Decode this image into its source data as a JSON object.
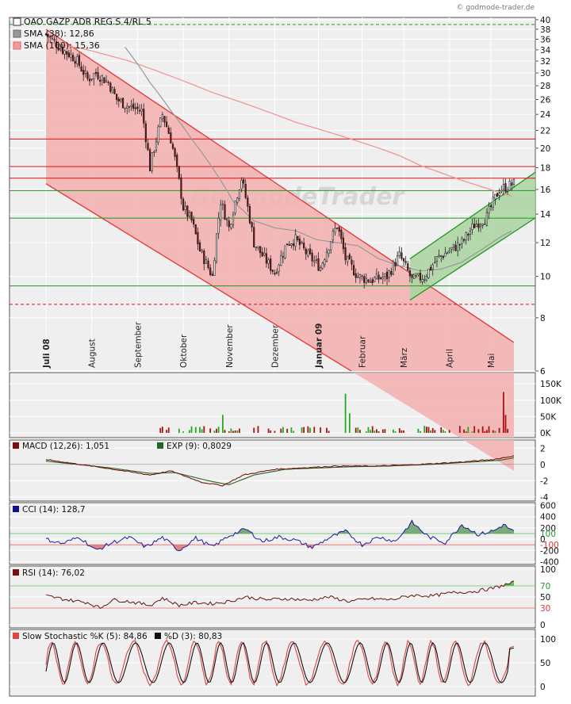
{
  "source": "© godmode-trader.de",
  "watermark": "GodmodeTrader",
  "chart_data": {
    "type": "candlestick",
    "title": "OAO GAZP ADR REG.S 4/RL 5",
    "legend": [
      {
        "label": "SMA (38): 12,86",
        "color": "#999999"
      },
      {
        "label": "SMA (100): 15,36",
        "color": "#ee8080"
      }
    ],
    "y_axis": {
      "scale": "log",
      "ylim": [
        6,
        40.5
      ],
      "ticks": [
        40,
        38,
        36,
        34,
        32,
        30,
        28,
        26,
        24,
        22,
        20,
        18,
        16,
        14,
        12,
        10,
        8,
        6
      ]
    },
    "x_labels": [
      "Juli 08",
      "August",
      "September",
      "Oktober",
      "November",
      "Dezember",
      "Januar 09",
      "Februar",
      "März",
      "April",
      "Mai"
    ],
    "x_labels_bold": [
      "Juli 08",
      "Januar 09"
    ],
    "n_bars": 226,
    "closes": [
      {
        "i": 0,
        "v": 37.0
      },
      {
        "i": 8,
        "v": 34.0
      },
      {
        "i": 14,
        "v": 32.5
      },
      {
        "i": 20,
        "v": 29.0
      },
      {
        "i": 24,
        "v": 30.0
      },
      {
        "i": 30,
        "v": 28.5
      },
      {
        "i": 34,
        "v": 26.0
      },
      {
        "i": 40,
        "v": 25.0
      },
      {
        "i": 46,
        "v": 24.5
      },
      {
        "i": 50,
        "v": 18.0
      },
      {
        "i": 56,
        "v": 24.0
      },
      {
        "i": 60,
        "v": 21.0
      },
      {
        "i": 66,
        "v": 14.5
      },
      {
        "i": 70,
        "v": 13.5
      },
      {
        "i": 74,
        "v": 11.5
      },
      {
        "i": 80,
        "v": 10.0
      },
      {
        "i": 84,
        "v": 15.0
      },
      {
        "i": 88,
        "v": 13.0
      },
      {
        "i": 94,
        "v": 17.0
      },
      {
        "i": 100,
        "v": 12.0
      },
      {
        "i": 104,
        "v": 11.2
      },
      {
        "i": 110,
        "v": 10.2
      },
      {
        "i": 116,
        "v": 12.0
      },
      {
        "i": 120,
        "v": 12.2
      },
      {
        "i": 126,
        "v": 11.2
      },
      {
        "i": 132,
        "v": 10.5
      },
      {
        "i": 140,
        "v": 13.2
      },
      {
        "i": 144,
        "v": 11.0
      },
      {
        "i": 150,
        "v": 10.0
      },
      {
        "i": 156,
        "v": 9.8
      },
      {
        "i": 164,
        "v": 10.0
      },
      {
        "i": 170,
        "v": 11.2
      },
      {
        "i": 176,
        "v": 9.8
      },
      {
        "i": 182,
        "v": 10.0
      },
      {
        "i": 188,
        "v": 11.0
      },
      {
        "i": 194,
        "v": 11.5
      },
      {
        "i": 200,
        "v": 12.0
      },
      {
        "i": 206,
        "v": 13.2
      },
      {
        "i": 212,
        "v": 13.8
      },
      {
        "i": 218,
        "v": 16.0
      },
      {
        "i": 225,
        "v": 16.5
      }
    ],
    "sma38": [
      {
        "i": 38,
        "v": 34.5
      },
      {
        "i": 50,
        "v": 28.5
      },
      {
        "i": 60,
        "v": 24.5
      },
      {
        "i": 70,
        "v": 21.0
      },
      {
        "i": 80,
        "v": 18.0
      },
      {
        "i": 90,
        "v": 15.0
      },
      {
        "i": 100,
        "v": 13.5
      },
      {
        "i": 110,
        "v": 13.0
      },
      {
        "i": 120,
        "v": 12.8
      },
      {
        "i": 130,
        "v": 12.2
      },
      {
        "i": 140,
        "v": 12.0
      },
      {
        "i": 150,
        "v": 11.8
      },
      {
        "i": 160,
        "v": 11.0
      },
      {
        "i": 170,
        "v": 10.6
      },
      {
        "i": 180,
        "v": 10.3
      },
      {
        "i": 190,
        "v": 10.4
      },
      {
        "i": 200,
        "v": 10.8
      },
      {
        "i": 210,
        "v": 11.6
      },
      {
        "i": 220,
        "v": 12.5
      },
      {
        "i": 225,
        "v": 12.86
      }
    ],
    "sma100": [
      {
        "i": 0,
        "v": 35.5
      },
      {
        "i": 20,
        "v": 34.0
      },
      {
        "i": 40,
        "v": 32.0
      },
      {
        "i": 60,
        "v": 29.5
      },
      {
        "i": 80,
        "v": 27.0
      },
      {
        "i": 100,
        "v": 25.0
      },
      {
        "i": 120,
        "v": 23.0
      },
      {
        "i": 140,
        "v": 21.5
      },
      {
        "i": 160,
        "v": 20.0
      },
      {
        "i": 170,
        "v": 19.2
      },
      {
        "i": 180,
        "v": 18.2
      },
      {
        "i": 190,
        "v": 17.5
      },
      {
        "i": 200,
        "v": 16.8
      },
      {
        "i": 210,
        "v": 16.2
      },
      {
        "i": 225,
        "v": 15.36
      }
    ],
    "horizontal_lines": [
      {
        "v": 39.0,
        "style": "dashed",
        "color": "#229922"
      },
      {
        "v": 21.0,
        "style": "solid",
        "color": "#dd1111"
      },
      {
        "v": 18.1,
        "style": "solid",
        "color": "#dd1111"
      },
      {
        "v": 17.0,
        "style": "solid",
        "color": "#dd1111"
      },
      {
        "v": 15.9,
        "style": "solid",
        "color": "#229922"
      },
      {
        "v": 13.7,
        "style": "solid",
        "color": "#229922"
      },
      {
        "v": 9.5,
        "style": "solid",
        "color": "#229922"
      },
      {
        "v": 8.6,
        "style": "dashed",
        "color": "#dd1111"
      }
    ],
    "down_channel": {
      "upper": [
        [
          0,
          38.0
        ],
        [
          225,
          7.0
        ]
      ],
      "lower": [
        [
          0,
          16.5
        ],
        [
          225,
          3.5
        ]
      ],
      "color": "#e53333",
      "fill": "#f3b3b3"
    },
    "up_channel": {
      "upper": [
        [
          175,
          11.0
        ],
        [
          240,
          18.2
        ]
      ],
      "lower": [
        [
          175,
          8.8
        ],
        [
          240,
          14.2
        ]
      ],
      "color": "#229922",
      "fill": "#a9d4a0"
    },
    "volume": {
      "ticks": [
        "150K",
        "100K",
        "50K",
        "0K"
      ],
      "ymax": 170,
      "spikes": [
        {
          "i": 85,
          "v": 55
        },
        {
          "i": 144,
          "v": 120
        },
        {
          "i": 146,
          "v": 60
        },
        {
          "i": 220,
          "v": 125
        },
        {
          "i": 221,
          "v": 55
        }
      ],
      "green": "#22aa22",
      "red": "#aa1111"
    },
    "macd": {
      "label": "MACD (12,26): 1,051",
      "signal_label": "EXP (9): 0,8029",
      "ticks": [
        "2",
        "0",
        "-2",
        "-4"
      ],
      "ylim": [
        -4.5,
        3
      ],
      "line": [
        {
          "i": 0,
          "v": 0.6
        },
        {
          "i": 30,
          "v": -0.5
        },
        {
          "i": 50,
          "v": -1.3
        },
        {
          "i": 60,
          "v": -0.8
        },
        {
          "i": 75,
          "v": -2.2
        },
        {
          "i": 85,
          "v": -2.6
        },
        {
          "i": 95,
          "v": -1.3
        },
        {
          "i": 110,
          "v": -0.6
        },
        {
          "i": 140,
          "v": -0.2
        },
        {
          "i": 160,
          "v": -0.2
        },
        {
          "i": 180,
          "v": 0
        },
        {
          "i": 200,
          "v": 0.3
        },
        {
          "i": 215,
          "v": 0.6
        },
        {
          "i": 225,
          "v": 1.05
        }
      ],
      "signal": [
        {
          "i": 0,
          "v": 0.4
        },
        {
          "i": 30,
          "v": -0.4
        },
        {
          "i": 50,
          "v": -1.1
        },
        {
          "i": 62,
          "v": -1.0
        },
        {
          "i": 78,
          "v": -2.0
        },
        {
          "i": 88,
          "v": -2.5
        },
        {
          "i": 100,
          "v": -1.3
        },
        {
          "i": 115,
          "v": -0.6
        },
        {
          "i": 145,
          "v": -0.3
        },
        {
          "i": 165,
          "v": -0.2
        },
        {
          "i": 185,
          "v": 0
        },
        {
          "i": 205,
          "v": 0.3
        },
        {
          "i": 218,
          "v": 0.5
        },
        {
          "i": 225,
          "v": 0.8
        }
      ]
    },
    "cci": {
      "label": "CCI (14): 128,7",
      "ticks": [
        "600",
        "400",
        "200",
        "100",
        "0",
        "-100",
        "-200",
        "-400"
      ],
      "ticks_colored": {
        "100": "#229922",
        "-100": "#dd3333"
      },
      "ylim": [
        -450,
        650
      ],
      "line": [
        {
          "i": 0,
          "v": 0
        },
        {
          "i": 8,
          "v": -80
        },
        {
          "i": 16,
          "v": 40
        },
        {
          "i": 24,
          "v": -200
        },
        {
          "i": 32,
          "v": -60
        },
        {
          "i": 40,
          "v": 30
        },
        {
          "i": 48,
          "v": -140
        },
        {
          "i": 56,
          "v": 30
        },
        {
          "i": 64,
          "v": -200
        },
        {
          "i": 72,
          "v": 20
        },
        {
          "i": 80,
          "v": -140
        },
        {
          "i": 88,
          "v": 60
        },
        {
          "i": 96,
          "v": 180
        },
        {
          "i": 104,
          "v": -40
        },
        {
          "i": 112,
          "v": 40
        },
        {
          "i": 120,
          "v": -20
        },
        {
          "i": 128,
          "v": -150
        },
        {
          "i": 136,
          "v": 20
        },
        {
          "i": 144,
          "v": 140
        },
        {
          "i": 152,
          "v": -100
        },
        {
          "i": 160,
          "v": 40
        },
        {
          "i": 168,
          "v": -40
        },
        {
          "i": 176,
          "v": 300
        },
        {
          "i": 184,
          "v": 40
        },
        {
          "i": 192,
          "v": -60
        },
        {
          "i": 200,
          "v": 260
        },
        {
          "i": 208,
          "v": 80
        },
        {
          "i": 216,
          "v": 160
        },
        {
          "i": 220,
          "v": 260
        },
        {
          "i": 225,
          "v": 128
        }
      ]
    },
    "rsi": {
      "label": "RSI (14): 76,02",
      "ticks": [
        "100",
        "70",
        "50",
        "30",
        "0"
      ],
      "ticks_colored": {
        "70": "#229922",
        "30": "#dd3333"
      },
      "ylim": [
        0,
        100
      ],
      "line": [
        {
          "i": 0,
          "v": 52
        },
        {
          "i": 10,
          "v": 45
        },
        {
          "i": 20,
          "v": 40
        },
        {
          "i": 26,
          "v": 30
        },
        {
          "i": 32,
          "v": 45
        },
        {
          "i": 40,
          "v": 42
        },
        {
          "i": 50,
          "v": 35
        },
        {
          "i": 56,
          "v": 48
        },
        {
          "i": 64,
          "v": 35
        },
        {
          "i": 72,
          "v": 40
        },
        {
          "i": 80,
          "v": 38
        },
        {
          "i": 88,
          "v": 42
        },
        {
          "i": 96,
          "v": 50
        },
        {
          "i": 106,
          "v": 45
        },
        {
          "i": 116,
          "v": 47
        },
        {
          "i": 126,
          "v": 44
        },
        {
          "i": 136,
          "v": 50
        },
        {
          "i": 146,
          "v": 42
        },
        {
          "i": 156,
          "v": 47
        },
        {
          "i": 166,
          "v": 45
        },
        {
          "i": 176,
          "v": 53
        },
        {
          "i": 186,
          "v": 52
        },
        {
          "i": 196,
          "v": 58
        },
        {
          "i": 206,
          "v": 60
        },
        {
          "i": 214,
          "v": 65
        },
        {
          "i": 225,
          "v": 76
        }
      ]
    },
    "stochastic": {
      "label": "Slow Stochastic %K (5): 84,86",
      "d_label": "%D (3): 80,83",
      "ticks": [
        "100",
        "50",
        "0"
      ],
      "ylim": [
        0,
        100
      ],
      "k": 84.86,
      "d": 80.83
    }
  }
}
